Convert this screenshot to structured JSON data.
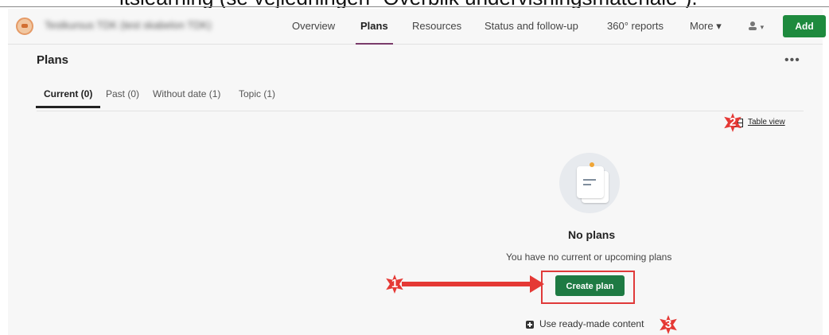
{
  "caption": "itslearning (se vejledningen \"Overblik undervisningsmateriale\").",
  "navbar": {
    "course_name": "Testkursus TDK (test skabelon TDK)",
    "links": [
      "Overview",
      "Plans",
      "Resources",
      "Status and follow-up",
      "360° reports",
      "More ▾"
    ],
    "active": "Plans",
    "user_menu": "▾",
    "add_label": "Add"
  },
  "page": {
    "title": "Plans",
    "more_label": "•••",
    "tabs": [
      "Current (0)",
      "Past (0)",
      "Without date (1)",
      "Topic (1)"
    ],
    "active_tab": "Current (0)",
    "table_view_label": "Table view"
  },
  "empty_state": {
    "title": "No plans",
    "subtitle": "You have no current or upcoming plans",
    "create_label": "Create plan",
    "ready_made_label": "Use ready-made content"
  },
  "callouts": [
    "1",
    "2",
    "3"
  ],
  "colors": {
    "accent": "#7a3b6b",
    "primary_green": "#1e8a3e",
    "callout_red": "#e53935"
  }
}
